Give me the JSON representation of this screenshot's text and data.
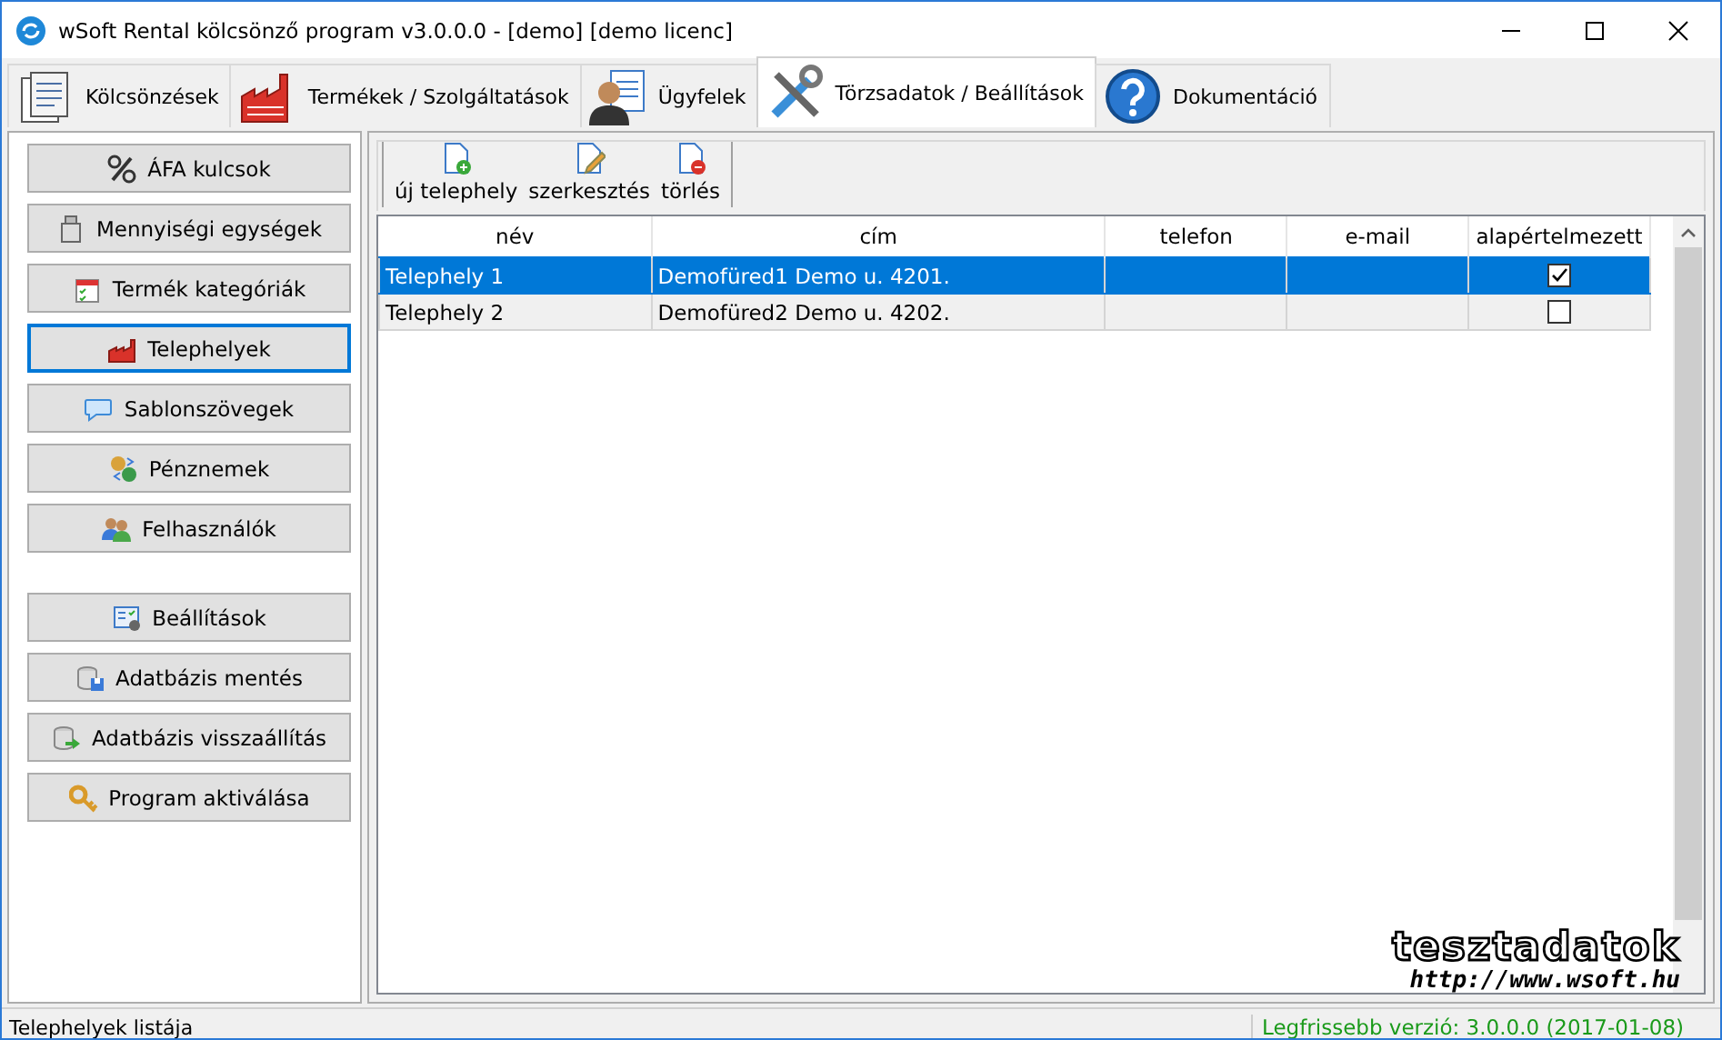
{
  "window": {
    "title": "wSoft Rental kölcsönző program v3.0.0.0 - [demo] [demo licenc]"
  },
  "tabs": [
    {
      "label": "Kölcsönzések",
      "selected": false
    },
    {
      "label": "Termékek / Szolgáltatások",
      "selected": false
    },
    {
      "label": "Ügyfelek",
      "selected": false
    },
    {
      "label": "Törzsadatok / Beállítások",
      "selected": true
    },
    {
      "label": "Dokumentáció",
      "selected": false
    }
  ],
  "sidebar": {
    "groups": [
      [
        {
          "label": "ÁFA kulcsok",
          "selected": false
        },
        {
          "label": "Mennyiségi egységek",
          "selected": false
        },
        {
          "label": "Termék kategóriák",
          "selected": false
        },
        {
          "label": "Telephelyek",
          "selected": true
        },
        {
          "label": "Sablonszövegek",
          "selected": false
        },
        {
          "label": "Pénznemek",
          "selected": false
        },
        {
          "label": "Felhasználók",
          "selected": false
        }
      ],
      [
        {
          "label": "Beállítások",
          "selected": false
        },
        {
          "label": "Adatbázis mentés",
          "selected": false
        },
        {
          "label": "Adatbázis visszaállítás",
          "selected": false
        },
        {
          "label": "Program aktiválása",
          "selected": false
        }
      ]
    ]
  },
  "toolbar": [
    {
      "label": "új telephely"
    },
    {
      "label": "szerkesztés"
    },
    {
      "label": "törlés"
    }
  ],
  "table": {
    "columns": [
      "név",
      "cím",
      "telefon",
      "e-mail",
      "alapértelmezett"
    ],
    "rows": [
      {
        "name": "Telephely 1",
        "address": "Demofüred1 Demo u. 4201.",
        "phone": "",
        "email": "",
        "default": true,
        "selected": true
      },
      {
        "name": "Telephely 2",
        "address": "Demofüred2 Demo u. 4202.",
        "phone": "",
        "email": "",
        "default": false,
        "selected": false
      }
    ]
  },
  "overlay": {
    "title": "tesztadatok",
    "url": "http://www.wsoft.hu"
  },
  "status_bar": {
    "left": "Telephelyek listája",
    "right": "Legfrissebb verzió: 3.0.0.0 (2017-01-08)"
  }
}
